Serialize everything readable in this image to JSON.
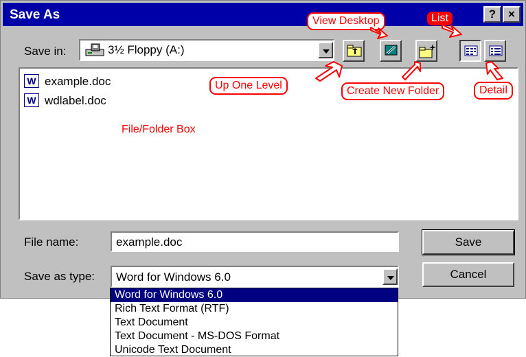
{
  "window": {
    "title": "Save As",
    "help_label": "?",
    "close_label": "×"
  },
  "toolbar": {
    "save_in_label": "Save in:",
    "save_in_value": "3½ Floppy (A:)",
    "buttons": [
      "up-one-level",
      "view-desktop",
      "create-new-folder",
      "list",
      "detail"
    ]
  },
  "files": [
    {
      "name": "example.doc",
      "icon": "word-doc-icon"
    },
    {
      "name": "wdlabel.doc",
      "icon": "word-doc-icon"
    }
  ],
  "annotations": {
    "view_desktop": "View Desktop",
    "list": "List",
    "up_one_level": "Up One Level",
    "create_new_folder": "Create New Folder",
    "detail": "Detail",
    "file_folder_box": "File/Folder Box"
  },
  "form": {
    "file_name_label": "File name:",
    "file_name_value": "example.doc",
    "save_as_type_label": "Save as type:",
    "save_as_type_value": "Word for Windows 6.0"
  },
  "buttons": {
    "save": "Save",
    "cancel": "Cancel"
  },
  "type_options": [
    "Word for Windows 6.0",
    "Rich Text Format (RTF)",
    "Text Document",
    "Text Document - MS-DOS Format",
    "Unicode Text Document"
  ],
  "colors": {
    "titlebar": "#0000a8",
    "annotation": "#ff0000",
    "dialog_face": "#c0c0c0"
  }
}
